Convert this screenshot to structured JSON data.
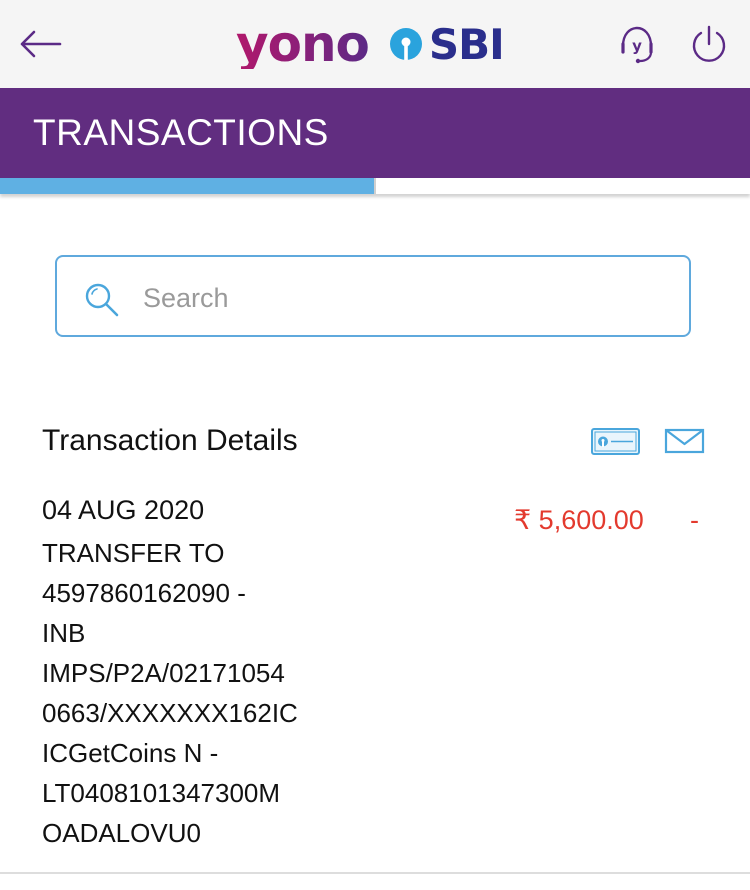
{
  "app": {
    "logo_yono": "yono",
    "logo_sbi": "SBI",
    "brand_purple": "#612d80",
    "accent_blue": "#5fb0e3",
    "amount_red": "#e33a2e"
  },
  "topbar": {
    "back_icon": "arrow-left-icon",
    "support_icon": "headset-support-icon",
    "power_icon": "power-icon"
  },
  "header": {
    "title": "TRANSACTIONS",
    "progress_fraction": 0.5
  },
  "search": {
    "placeholder": "Search",
    "value": ""
  },
  "transactions": {
    "section_title": "Transaction Details",
    "passbook_icon": "passbook-icon",
    "mail_icon": "mail-icon",
    "items": [
      {
        "date": "04 AUG 2020",
        "amount": "₹ 5,600.00",
        "direction": "-",
        "description_lines": [
          "TRANSFER TO",
          "4597860162090 -",
          "INB",
          "IMPS/P2A/02171054",
          "0663/XXXXXXX162IC",
          "ICGetCoins N -",
          "LT0408101347300M",
          "OADALOVU0"
        ]
      }
    ]
  }
}
